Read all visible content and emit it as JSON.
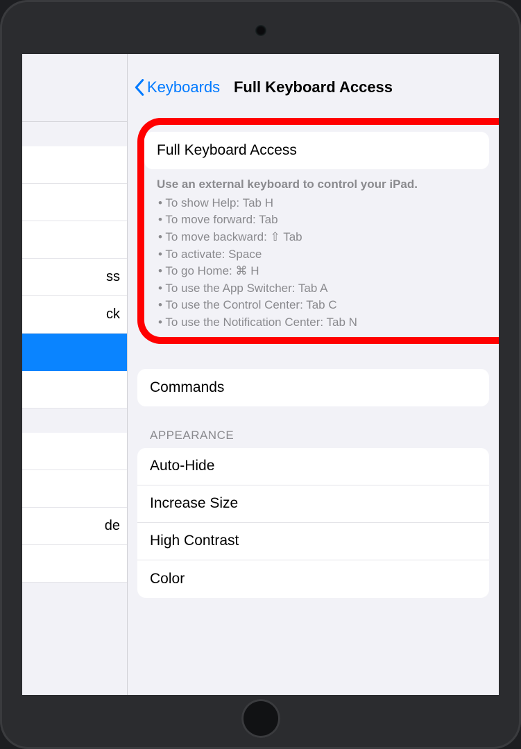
{
  "nav": {
    "back_label": "Keyboards",
    "title": "Full Keyboard Access"
  },
  "sidebar": {
    "items": [
      {
        "label": "",
        "blank": true
      },
      {
        "label": "",
        "blank": true
      },
      {
        "label": "",
        "blank": true
      },
      {
        "label": "ss"
      },
      {
        "label": "ck"
      },
      {
        "label": "",
        "selected": true,
        "blank": true
      },
      {
        "label": "",
        "blank": true
      },
      {
        "label": "",
        "blank": true
      },
      {
        "label": "",
        "blank": true
      },
      {
        "label": "de"
      },
      {
        "label": "",
        "blank": true
      }
    ]
  },
  "main_switch": {
    "label": "Full Keyboard Access"
  },
  "help": {
    "lead": "Use an external keyboard to control your iPad.",
    "lines": [
      "To show Help: Tab H",
      "To move forward: Tab",
      "To move backward: ⇧ Tab",
      "To activate: Space",
      "To go Home: ⌘ H",
      "To use the App Switcher: Tab A",
      "To use the Control Center: Tab C",
      "To use the Notification Center: Tab N"
    ]
  },
  "commands": {
    "label": "Commands"
  },
  "appearance": {
    "header": "APPEARANCE",
    "rows": [
      "Auto-Hide",
      "Increase Size",
      "High Contrast",
      "Color"
    ]
  }
}
